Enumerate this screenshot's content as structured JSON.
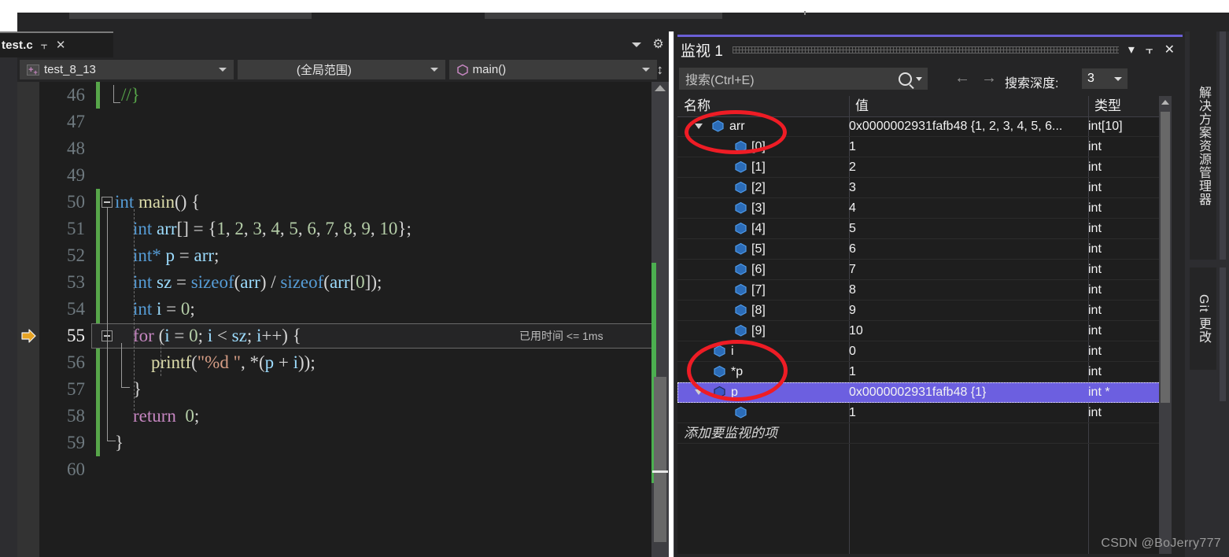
{
  "editor": {
    "tab": {
      "title": "test.c",
      "pin_icon": "pin-icon",
      "close_icon": "close-icon"
    },
    "navbar": {
      "project": "test_8_13",
      "scope": "(全局范围)",
      "function": "main()"
    },
    "lines": [
      {
        "no": "46",
        "current": false
      },
      {
        "no": "47",
        "current": false
      },
      {
        "no": "48",
        "current": false
      },
      {
        "no": "49",
        "current": false
      },
      {
        "no": "50",
        "current": false
      },
      {
        "no": "51",
        "current": false
      },
      {
        "no": "52",
        "current": false
      },
      {
        "no": "53",
        "current": false
      },
      {
        "no": "54",
        "current": false
      },
      {
        "no": "55",
        "current": true
      },
      {
        "no": "56",
        "current": false
      },
      {
        "no": "57",
        "current": false
      },
      {
        "no": "58",
        "current": false
      },
      {
        "no": "59",
        "current": false
      },
      {
        "no": "60",
        "current": false
      }
    ],
    "code": {
      "l46": "//}",
      "l50": "int main() {",
      "l51": "int arr[] = {1, 2, 3, 4, 5, 6, 7, 8, 9, 10};",
      "l52": "int* p = arr;",
      "l53": "int sz = sizeof(arr) / sizeof(arr[0]);",
      "l54": "int i = 0;",
      "l55": "for (i = 0; i < sz; i++) {",
      "l56": "printf(\"%d \", *(p + i));",
      "l57": "}",
      "l58": "return  0;",
      "l59": "}"
    },
    "tokens": {
      "comment_46": "//}",
      "kw_int": "int",
      "kw_for": "for",
      "kw_return": "return",
      "id_main": "main",
      "id_arr": "arr",
      "id_p": "p",
      "id_sz": "sz",
      "id_i": "i",
      "id_sizeof": "sizeof",
      "fn_printf": "printf",
      "str_fmt": "\"%d \"",
      "num_0": "0",
      "num_1": "1",
      "num_2": "2",
      "num_3": "3",
      "num_4": "4",
      "num_5": "5",
      "num_6": "6",
      "num_7": "7",
      "num_8": "8",
      "num_9": "9",
      "num_10": "10"
    },
    "elapsed_badge": "已用时间 <= 1ms"
  },
  "watch": {
    "title": "监视 1",
    "search_placeholder": "搜索(Ctrl+E)",
    "search_depth_label": "搜索深度:",
    "search_depth_value": "3",
    "prev_icon": "←",
    "next_icon": "→",
    "columns": [
      "名称",
      "值",
      "类型"
    ],
    "add_row_placeholder": "添加要监视的项",
    "rows": [
      {
        "name": "arr",
        "value": "0x0000002931fafb48 {1, 2, 3, 4, 5, 6...",
        "type": "int[10]",
        "depth": 0,
        "twisty": "open",
        "selected": false
      },
      {
        "name": "[0]",
        "value": "1",
        "type": "int",
        "depth": 1,
        "twisty": "none",
        "selected": false
      },
      {
        "name": "[1]",
        "value": "2",
        "type": "int",
        "depth": 1,
        "twisty": "none",
        "selected": false
      },
      {
        "name": "[2]",
        "value": "3",
        "type": "int",
        "depth": 1,
        "twisty": "none",
        "selected": false
      },
      {
        "name": "[3]",
        "value": "4",
        "type": "int",
        "depth": 1,
        "twisty": "none",
        "selected": false
      },
      {
        "name": "[4]",
        "value": "5",
        "type": "int",
        "depth": 1,
        "twisty": "none",
        "selected": false
      },
      {
        "name": "[5]",
        "value": "6",
        "type": "int",
        "depth": 1,
        "twisty": "none",
        "selected": false
      },
      {
        "name": "[6]",
        "value": "7",
        "type": "int",
        "depth": 1,
        "twisty": "none",
        "selected": false
      },
      {
        "name": "[7]",
        "value": "8",
        "type": "int",
        "depth": 1,
        "twisty": "none",
        "selected": false
      },
      {
        "name": "[8]",
        "value": "9",
        "type": "int",
        "depth": 1,
        "twisty": "none",
        "selected": false
      },
      {
        "name": "[9]",
        "value": "10",
        "type": "int",
        "depth": 1,
        "twisty": "none",
        "selected": false
      },
      {
        "name": "i",
        "value": "0",
        "type": "int",
        "depth": 0,
        "twisty": "none",
        "selected": false
      },
      {
        "name": "*p",
        "value": "1",
        "type": "int",
        "depth": 0,
        "twisty": "none",
        "selected": false
      },
      {
        "name": "p",
        "value": "0x0000002931fafb48 {1}",
        "type": "int *",
        "depth": 0,
        "twisty": "open",
        "selected": true
      },
      {
        "name": "",
        "value": "1",
        "type": "int",
        "depth": 1,
        "twisty": "none",
        "selected": false
      }
    ]
  },
  "right_rail": {
    "tabs": [
      "解决方案资源管理器",
      "Git 更改"
    ]
  },
  "annotations": {
    "watermark": "CSDN @BoJerry777"
  }
}
